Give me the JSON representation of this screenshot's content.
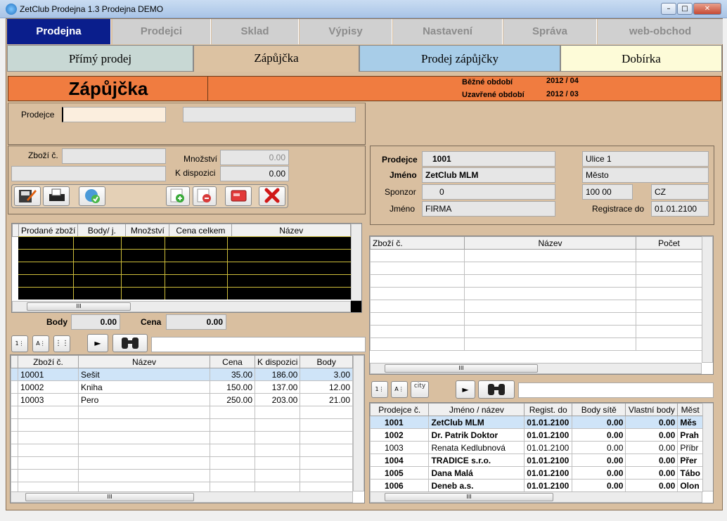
{
  "window": {
    "title": "ZetClub Prodejna 1.3  Prodejna DEMO"
  },
  "main_tabs": [
    "Prodejna",
    "Prodejci",
    "Sklad",
    "Výpisy",
    "Nastavení",
    "Správa",
    "web-obchod"
  ],
  "sub_tabs": [
    "Přímý prodej",
    "Zápůjčka",
    "Prodej zápůjčky",
    "Dobírka"
  ],
  "header": {
    "title": "Zápůjčka",
    "current_period_label": "Běžné období",
    "current_period": "2012 / 04",
    "closed_period_label": "Uzavřené období",
    "closed_period": "2012 / 03"
  },
  "seller": {
    "label": "Prodejce",
    "value": "",
    "name": ""
  },
  "item": {
    "label": "Zboží č.",
    "value": "",
    "desc": "",
    "qty_label": "Množství",
    "qty": "0.00",
    "avail_label": "K dispozici",
    "avail": "0.00"
  },
  "sold": {
    "columns": [
      "Prodané zboží",
      "Body/ j.",
      "Množství",
      "Cena celkem",
      "Název"
    ],
    "body_label": "Body",
    "body": "0.00",
    "price_label": "Cena",
    "price": "0.00"
  },
  "stock": {
    "columns": [
      "Zboží č.",
      "Název",
      "Cena",
      "K dispozici",
      "Body"
    ],
    "rows": [
      [
        "10001",
        "Sešit",
        "35.00",
        "186.00",
        "3.00"
      ],
      [
        "10002",
        "Kniha",
        "150.00",
        "137.00",
        "12.00"
      ],
      [
        "10003",
        "Pero",
        "250.00",
        "203.00",
        "21.00"
      ]
    ],
    "search": ""
  },
  "member": {
    "seller_label": "Prodejce",
    "seller": "1001",
    "name_label": "Jméno",
    "name": "ZetClub MLM",
    "sponsor_label": "Sponzor",
    "sponsor": "0",
    "name2_label": "Jméno",
    "name2": "FIRMA",
    "street": "Ulice 1",
    "city": "Město",
    "zip": "100 00",
    "country": "CZ",
    "reg_label": "Registrace do",
    "reg": "01.01.2100"
  },
  "loan_items": {
    "columns": [
      "Zboží č.",
      "Název",
      "Počet"
    ]
  },
  "members": {
    "columns": [
      "Prodejce č.",
      "Jméno / název",
      "Regist. do",
      "Body sítě",
      "Vlastní body",
      "Měst"
    ],
    "rows": [
      [
        "1001",
        "ZetClub MLM",
        "01.01.2100",
        "0.00",
        "0.00",
        "Měs"
      ],
      [
        "1002",
        "Dr. Patrik  Doktor",
        "01.01.2100",
        "0.00",
        "0.00",
        "Prah"
      ],
      [
        "1003",
        "Renata  Kedlubnová",
        "01.01.2100",
        "0.00",
        "0.00",
        "Příbr"
      ],
      [
        "1004",
        "TRADICE s.r.o.",
        "01.01.2100",
        "0.00",
        "0.00",
        "Přer"
      ],
      [
        "1005",
        "Dana  Malá",
        "01.01.2100",
        "0.00",
        "0.00",
        "Tábo"
      ],
      [
        "1006",
        "Deneb a.s.",
        "01.01.2100",
        "0.00",
        "0.00",
        "Olon"
      ]
    ],
    "search": "",
    "city_btn": "city"
  },
  "scroll_mark": "III"
}
